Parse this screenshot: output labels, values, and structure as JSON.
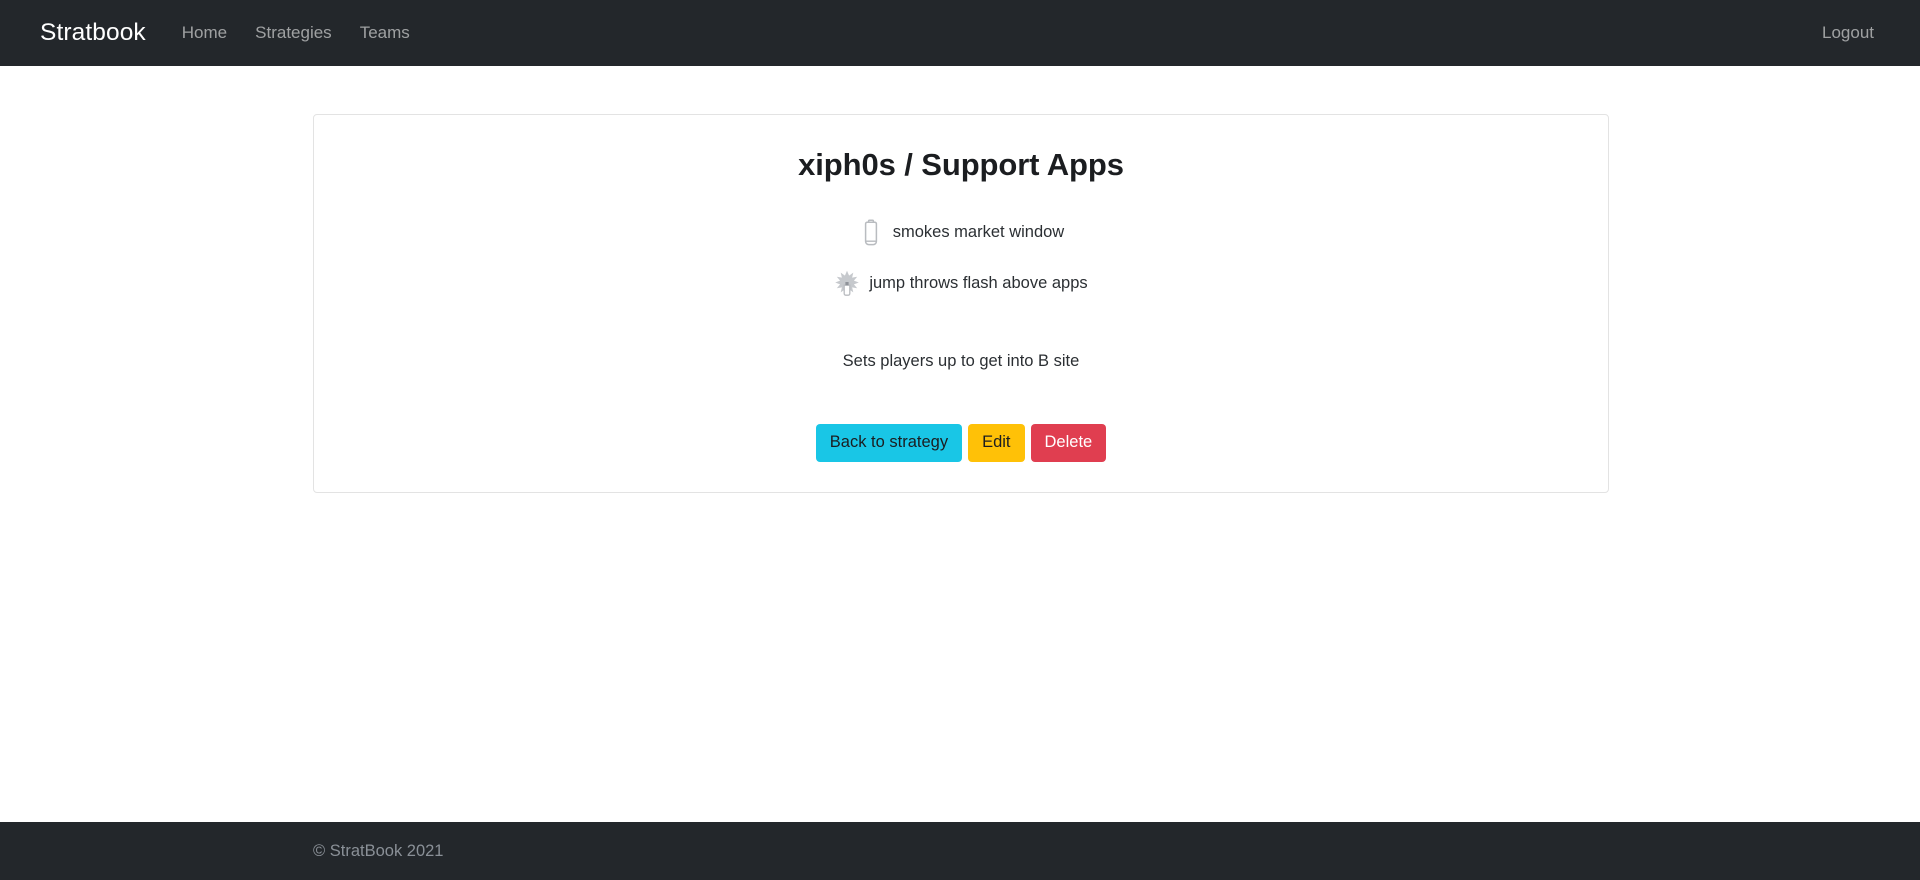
{
  "navbar": {
    "brand": "Stratbook",
    "links": [
      {
        "label": "Home",
        "name": "nav-link-home"
      },
      {
        "label": "Strategies",
        "name": "nav-link-strategies"
      },
      {
        "label": "Teams",
        "name": "nav-link-teams"
      }
    ],
    "logout_label": "Logout",
    "background_color": "#23272b"
  },
  "card": {
    "title": "xiph0s / Support Apps",
    "abilities": [
      {
        "icon": "smoke-grenade-icon",
        "text": "smokes market window"
      },
      {
        "icon": "flashbang-icon",
        "text": "jump throws flash above apps"
      }
    ],
    "description": "Sets players up to get into B site",
    "buttons": [
      {
        "label": "Back to strategy",
        "name": "back-to-strategy-button",
        "color": "#19c6e6"
      },
      {
        "label": "Edit",
        "name": "edit-button",
        "color": "#ffc107"
      },
      {
        "label": "Delete",
        "name": "delete-button",
        "color": "#e03e50"
      }
    ]
  },
  "footer": {
    "text": "© StratBook 2021"
  }
}
